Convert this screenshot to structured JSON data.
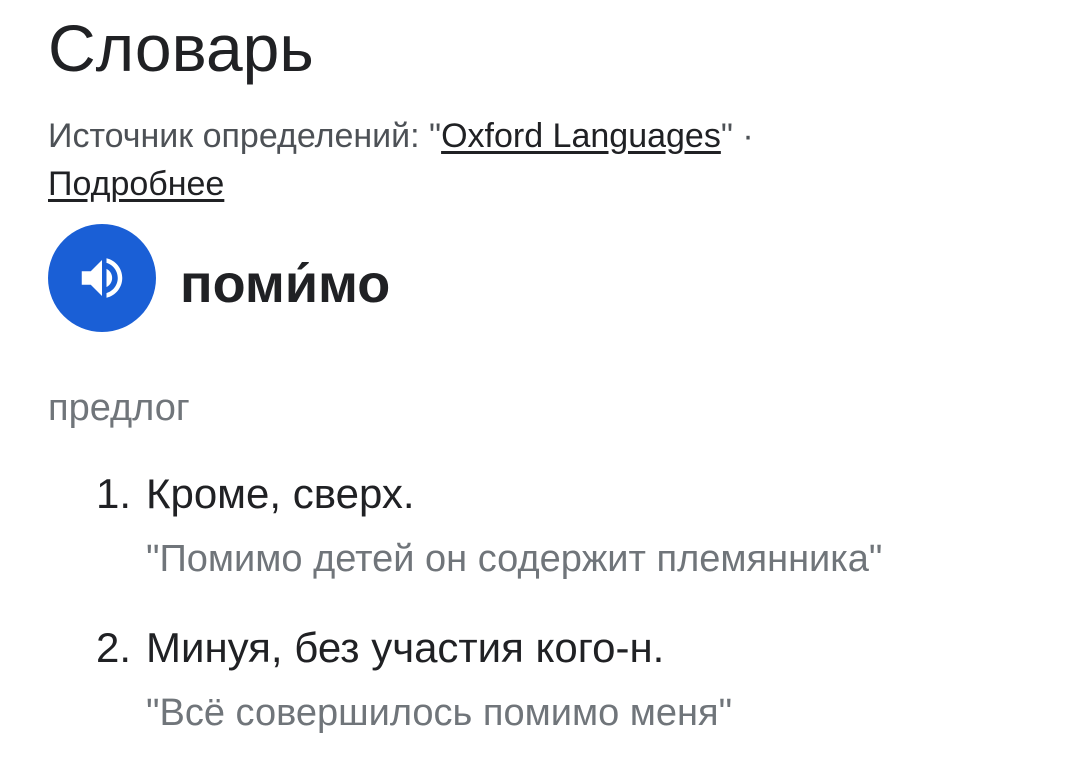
{
  "title": "Словарь",
  "source": {
    "prefix": "Источник определений: \"",
    "link_label": "Oxford Languages",
    "suffix": "\" ·",
    "more_label": "Подробнее"
  },
  "entry": {
    "audio_icon": "speaker-icon",
    "headword": "поми́мо",
    "part_of_speech": "предлог",
    "senses": [
      {
        "number": "1.",
        "definition": "Кроме, сверх.",
        "example": "\"Помимо детей он содержит племянника\""
      },
      {
        "number": "2.",
        "definition": "Минуя, без участия кого-н.",
        "example": "\"Всё совершилось помимо меня\""
      }
    ]
  },
  "colors": {
    "accent": "#1a5fd6",
    "text_primary": "#202124",
    "text_secondary": "#70757a"
  }
}
